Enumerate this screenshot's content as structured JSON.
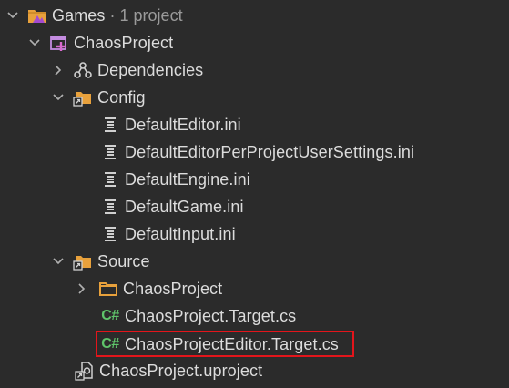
{
  "tree": {
    "root": {
      "label": "Games",
      "separator": "·",
      "count": "1 project",
      "icon": "solution-folder-icon"
    },
    "project": {
      "label": "ChaosProject",
      "icon": "project-icon"
    },
    "dependencies": {
      "label": "Dependencies",
      "icon": "dependencies-icon"
    },
    "config": {
      "label": "Config",
      "icon": "folder-link-icon",
      "files": [
        "DefaultEditor.ini",
        "DefaultEditorPerProjectUserSettings.ini",
        "DefaultEngine.ini",
        "DefaultGame.ini",
        "DefaultInput.ini"
      ]
    },
    "source": {
      "label": "Source",
      "icon": "folder-link-icon",
      "subfolder": "ChaosProject",
      "cs_badge": "C#",
      "cs_files": [
        "ChaosProject.Target.cs",
        "ChaosProjectEditor.Target.cs"
      ]
    },
    "uproject": {
      "label": "ChaosProject.uproject",
      "icon": "uproject-file-icon"
    }
  },
  "colors": {
    "background": "#2b2b2b",
    "text": "#dcdcdc",
    "muted": "#9a9a9a",
    "csharp": "#5fc46a",
    "folder": "#e8a13c",
    "highlight": "#e3151b"
  }
}
